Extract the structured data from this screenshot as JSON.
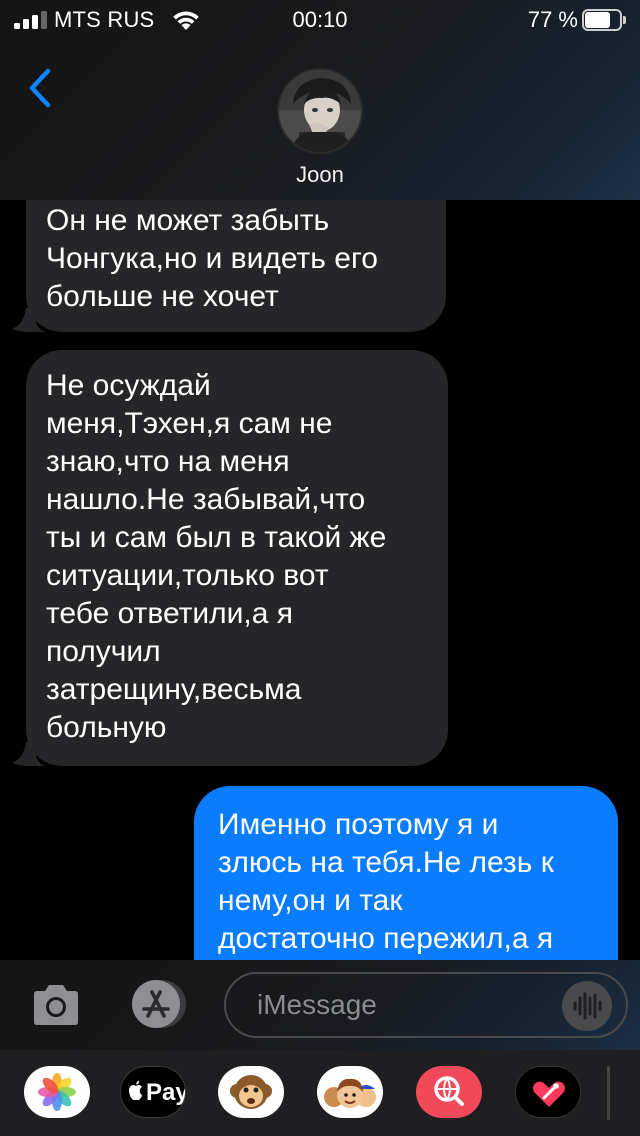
{
  "status_bar": {
    "carrier": "MTS RUS",
    "time": "00:10",
    "battery_percent": "77 %",
    "battery_level": 0.77,
    "signal_bars": 3,
    "signal_bars_total": 4
  },
  "header": {
    "contact_name": "Joon",
    "back_icon": "chevron-left-icon",
    "accent_color": "#0a84ff"
  },
  "messages": [
    {
      "direction": "incoming",
      "lines": [
        "Он не может забыть",
        "Чонгука,но и видеть его",
        "больше не хочет"
      ]
    },
    {
      "direction": "incoming",
      "lines": [
        "Не осуждай",
        "меня,Тэхен,я сам не",
        "знаю,что на меня",
        "нашло.Не забывай,что",
        "ты и сам был в такой же",
        "ситуации,только вот",
        "тебе ответили,а я",
        "получил",
        "затрещину,весьма",
        "больную"
      ]
    },
    {
      "direction": "outgoing",
      "lines": [
        "Именно поэтому я и",
        "злюсь на тебя.Не лезь к",
        "нему,он и так",
        "достаточно пережил,а я"
      ]
    }
  ],
  "colors": {
    "incoming_bubble": "#262628",
    "outgoing_bubble": "#0a7cff"
  },
  "input_bar": {
    "placeholder": "iMessage",
    "camera_icon": "camera-icon",
    "appstore_icon": "app-store-icon",
    "audio_icon": "audio-waveform-icon"
  },
  "app_drawer": {
    "apple_pay_label": "Pay",
    "apps": [
      "photos-icon",
      "apple-pay-icon",
      "animoji-monkey-icon",
      "memoji-icon",
      "web-search-icon",
      "digital-touch-icon"
    ]
  }
}
